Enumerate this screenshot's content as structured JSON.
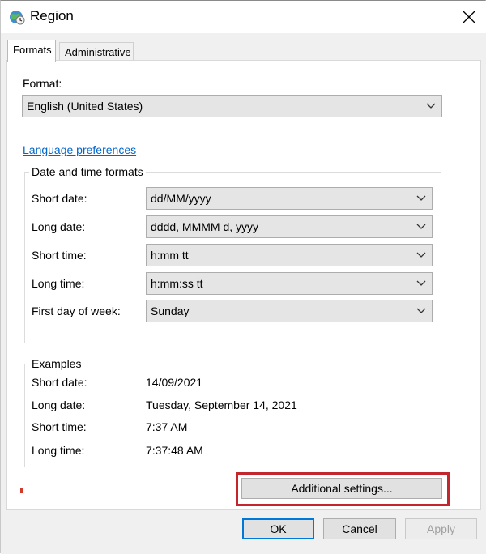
{
  "window": {
    "title": "Region",
    "icon": "globe-clock-icon",
    "close_icon": "close-icon"
  },
  "tabs": [
    {
      "label": "Formats",
      "active": true
    },
    {
      "label": "Administrative",
      "active": false
    }
  ],
  "format": {
    "label": "Format:",
    "value": "English (United States)"
  },
  "language_link": "Language preferences",
  "date_time_formats": {
    "title": "Date and time formats",
    "rows": [
      {
        "label": "Short date:",
        "value": "dd/MM/yyyy"
      },
      {
        "label": "Long date:",
        "value": "dddd, MMMM d, yyyy"
      },
      {
        "label": "Short time:",
        "value": "h:mm tt"
      },
      {
        "label": "Long time:",
        "value": "h:mm:ss tt"
      },
      {
        "label": "First day of week:",
        "value": "Sunday"
      }
    ]
  },
  "examples": {
    "title": "Examples",
    "rows": [
      {
        "label": "Short date:",
        "value": "14/09/2021"
      },
      {
        "label": "Long date:",
        "value": "Tuesday, September 14, 2021"
      },
      {
        "label": "Short time:",
        "value": "7:37 AM"
      },
      {
        "label": "Long time:",
        "value": "7:37:48 AM"
      }
    ]
  },
  "buttons": {
    "additional_settings": "Additional settings...",
    "ok": "OK",
    "cancel": "Cancel",
    "apply": "Apply"
  },
  "colors": {
    "highlight": "#c4262e",
    "link": "#0066cc",
    "default_button_border": "#0078d7"
  }
}
